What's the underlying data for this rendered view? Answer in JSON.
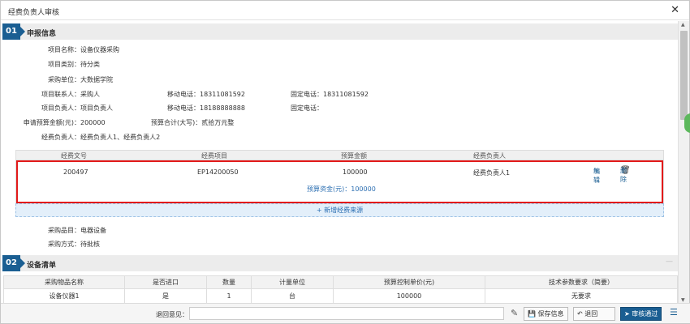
{
  "dialog": {
    "title": "经费负责人审核"
  },
  "section1": {
    "num": "01",
    "title": "申报信息",
    "fields": {
      "project_name_label": "项目名称：",
      "project_name": "设备仪器采购",
      "project_type_label": "项目类别：",
      "project_type": "待分类",
      "purchase_unit_label": "采购单位：",
      "purchase_unit": "大数据学院",
      "contact_label": "项目联系人：",
      "contact": "采购人",
      "contact_mobile_label": "移动电话：",
      "contact_mobile": "18311081592",
      "contact_phone_label": "固定电话：",
      "contact_phone": "18311081592",
      "leader_label": "项目负责人：",
      "leader": "项目负责人",
      "leader_mobile_label": "移动电话：",
      "leader_mobile": "18188888888",
      "leader_phone_label": "固定电话：",
      "leader_phone": "",
      "budget_label": "申请预算金额(元)：",
      "budget": "200000",
      "budget_cn_label": "预算合计(大写)：",
      "budget_cn": "贰拾万元整",
      "fee_leader_label": "经费负责人：",
      "fee_leader": "经费负责人1、经费负责人2"
    },
    "fee_table": {
      "headers": [
        "经费文号",
        "经费项目",
        "预算金额",
        "经费负责人"
      ],
      "row": [
        "200497",
        "EP14200050",
        "100000",
        "经费负责人1"
      ],
      "edit": "编辑",
      "delete": "删除",
      "budget_note": "预算资金(元)：100000"
    },
    "add_fee": "+ 新增经费来源",
    "purchase_item_label": "采购品目：",
    "purchase_item": "电器设备",
    "purchase_method_label": "采购方式：",
    "purchase_method": "待批核"
  },
  "section2": {
    "num": "02",
    "title": "设备清单",
    "headers": [
      "采购物品名称",
      "是否进口",
      "数量",
      "计量单位",
      "预算控制单价(元)",
      "技术参数要求（简要）"
    ],
    "rows": [
      [
        "设备仪器1",
        "是",
        "1",
        "台",
        "100000",
        "无要求"
      ]
    ]
  },
  "footer": {
    "return_label": "退回意见：",
    "return_value": "",
    "save": "保存信息",
    "back": "退回",
    "approve": "审核通过"
  }
}
